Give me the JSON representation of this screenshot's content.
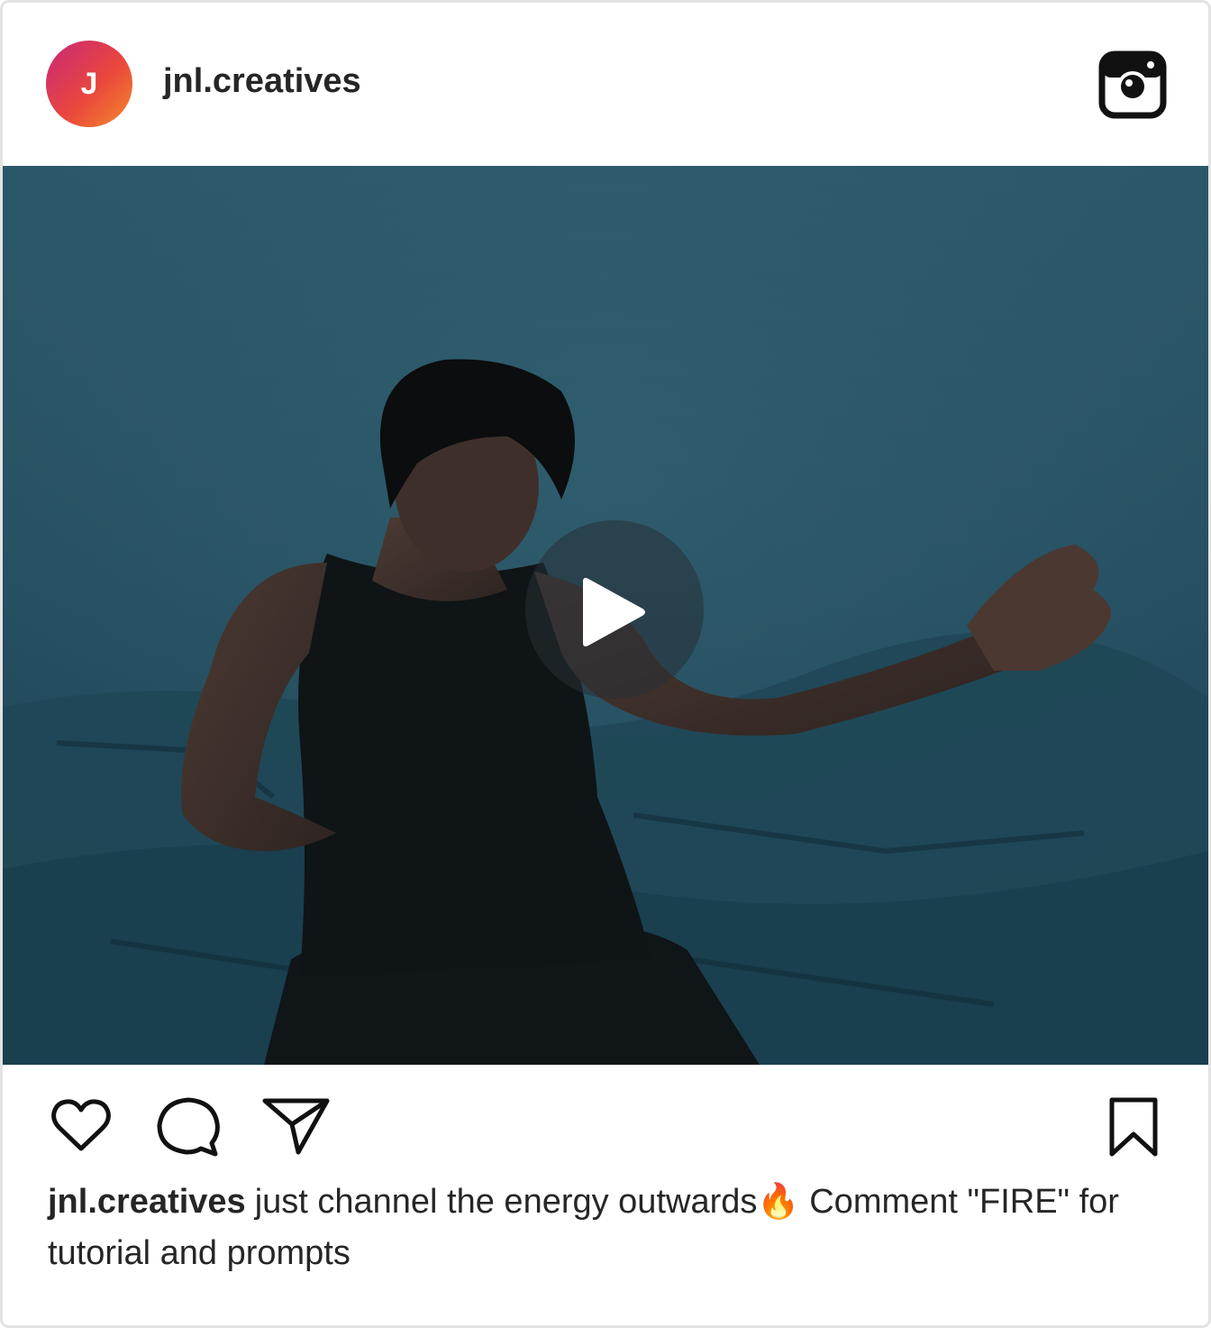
{
  "post": {
    "avatar_initial": "J",
    "username": "jnl.creatives",
    "header_icon": "instagram-icon",
    "media": {
      "type": "video",
      "play_icon": "play-icon"
    },
    "actions": {
      "like_icon": "heart-icon",
      "comment_icon": "comment-icon",
      "share_icon": "share-icon",
      "save_icon": "bookmark-icon"
    },
    "caption": {
      "username": "jnl.creatives",
      "text": "just channel the energy outwards🔥 Comment \"FIRE\" for tutorial and prompts"
    }
  },
  "colors": {
    "avatar_gradient_start": "#c8287a",
    "avatar_gradient_end": "#f6892b",
    "text": "#262626",
    "border": "#e3e3e3",
    "scene": "#1e4656"
  }
}
